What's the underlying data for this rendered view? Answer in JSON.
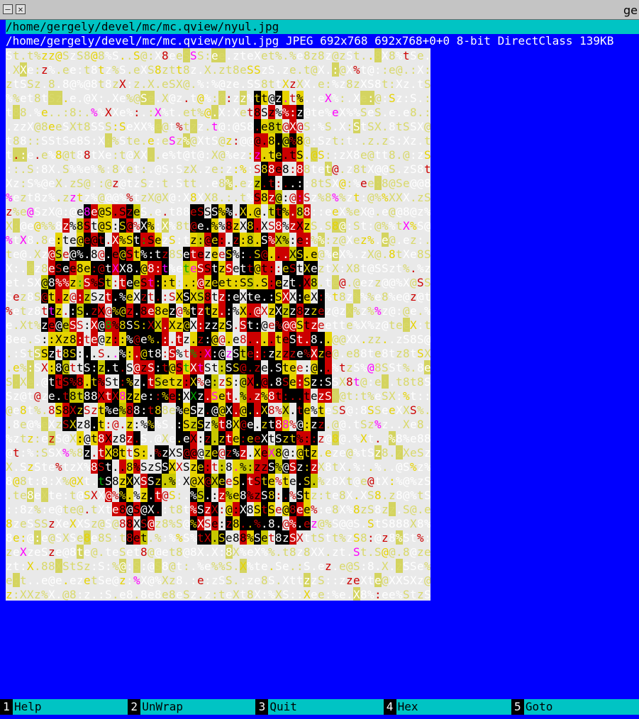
{
  "window": {
    "title": "ge",
    "minimize_glyph": "–",
    "close_glyph": "✕"
  },
  "viewer": {
    "path": "/home/gergely/devel/mc/mc.qview/nyul.jpg",
    "status": "/home/gergely/devel/mc/mc.qview/nyul.jpg JPEG 692x768 692x768+0+0 8-bit DirectClass 139KB",
    "ascii_art_glyphs": "X8S@%z.t:e",
    "colors": {
      "background": "#0000ff",
      "image_background": "#e9e9e9",
      "bars": "#00c4c4",
      "art_palette": [
        "#ffffff",
        "#d9d96a",
        "#e6d300",
        "#cc0000",
        "#000000",
        "#ff00ff",
        "#00aa00",
        "#888888"
      ]
    }
  },
  "function_keys": [
    {
      "num": "1",
      "label": "Help"
    },
    {
      "num": "2",
      "label": "UnWrap"
    },
    {
      "num": "3",
      "label": "Quit"
    },
    {
      "num": "4",
      "label": "Hex"
    },
    {
      "num": "5",
      "label": "Goto"
    }
  ]
}
